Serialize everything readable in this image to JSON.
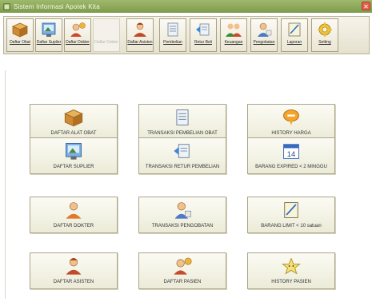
{
  "window": {
    "title": "Sistem Informasi Apotek Kita"
  },
  "toolbar": {
    "items": [
      {
        "label": "Daftar Obat",
        "icon": "medicine-box-icon",
        "enabled": true
      },
      {
        "label": "Daftar Suplier",
        "icon": "supplier-icon",
        "enabled": true
      },
      {
        "label": "Daftar Dokter",
        "icon": "doctor-icon",
        "enabled": true
      },
      {
        "label": "Daftar Dokter",
        "icon": "doctor-icon",
        "enabled": false
      },
      {
        "label": "Daftar Asisten",
        "icon": "assistant-icon",
        "enabled": true
      },
      {
        "label": "Pembelian",
        "icon": "purchase-doc-icon",
        "enabled": true
      },
      {
        "label": "Retur Beli",
        "icon": "return-icon",
        "enabled": true
      },
      {
        "label": "Keuangan",
        "icon": "finance-icon",
        "enabled": true
      },
      {
        "label": "Pengobatan",
        "icon": "treatment-icon",
        "enabled": true
      },
      {
        "label": "Laporan",
        "icon": "report-icon",
        "enabled": true
      },
      {
        "label": "Setting",
        "icon": "gear-icon",
        "enabled": true
      }
    ]
  },
  "menu": {
    "tiles": [
      {
        "label": "DAFTAR ALAT OBAT",
        "icon": "medicine-box-icon"
      },
      {
        "label": "TRANSAKSI PEMBELIAN OBAT",
        "icon": "purchase-doc-icon"
      },
      {
        "label": "HISTORY HARGA",
        "icon": "price-history-icon"
      },
      {
        "label": "DAFTAR SUPLIER",
        "icon": "supplier-icon"
      },
      {
        "label": "TRANSAKSI RETUR PEMBELIAN",
        "icon": "return-icon"
      },
      {
        "label": "BARANG EXPIRED < 2 MINGGU",
        "icon": "calendar-icon"
      },
      {
        "label": "DAFTAR DOKTER",
        "icon": "doctor-icon"
      },
      {
        "label": "TRANSAKSI PENGOBATAN",
        "icon": "treatment-icon"
      },
      {
        "label": "BARANG LIMIT < 10 satuan",
        "icon": "limit-note-icon"
      },
      {
        "label": "DAFTAR ASISTEN",
        "icon": "assistant-icon"
      },
      {
        "label": "DAFTAR PASIEN",
        "icon": "patient-icon"
      },
      {
        "label": "HISTORY PASIEN",
        "icon": "patient-history-icon"
      }
    ]
  },
  "colors": {
    "titlebar": "#8aa75a",
    "tile_border": "#aaa58a",
    "close": "#e4604c"
  }
}
